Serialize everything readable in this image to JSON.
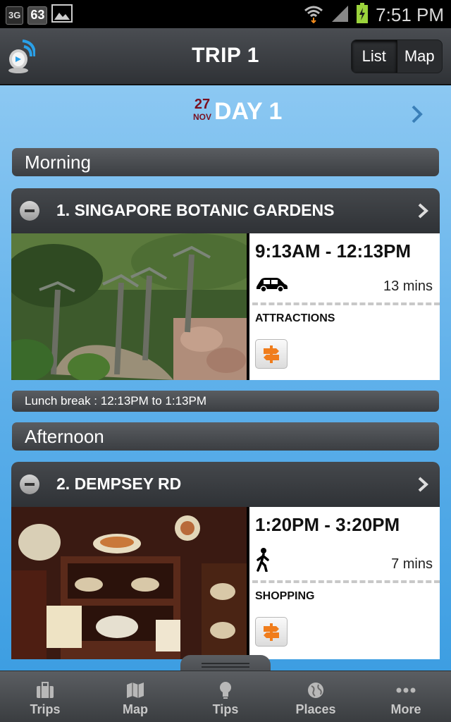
{
  "status_bar": {
    "network_label": "3G",
    "battery_notification": "63",
    "time": "7:51 PM"
  },
  "header": {
    "title": "TRIP 1",
    "view_toggle": {
      "list_label": "List",
      "map_label": "Map",
      "selected": "List"
    }
  },
  "day": {
    "date_day": "27",
    "date_month": "NOV",
    "label": "DAY 1"
  },
  "sections": {
    "morning": "Morning",
    "afternoon": "Afternoon",
    "lunch_break": "Lunch break : 12:13PM to 1:13PM"
  },
  "itinerary": [
    {
      "title": "1. SINGAPORE BOTANIC GARDENS",
      "time_range": "9:13AM - 12:13PM",
      "travel_mode_icon": "car-icon",
      "travel_time": "13 mins",
      "category": "ATTRACTIONS",
      "category_icon": "signpost-icon"
    },
    {
      "title": "2. DEMPSEY RD",
      "time_range": "1:20PM - 3:20PM",
      "travel_mode_icon": "walking-icon",
      "travel_time": "7 mins",
      "category": "SHOPPING",
      "category_icon": "signpost-icon"
    }
  ],
  "tabs": [
    {
      "label": "Trips",
      "icon": "suitcase-icon"
    },
    {
      "label": "Map",
      "icon": "map-icon"
    },
    {
      "label": "Tips",
      "icon": "lightbulb-icon"
    },
    {
      "label": "Places",
      "icon": "globe-icon"
    },
    {
      "label": "More",
      "icon": "more-dots-icon"
    }
  ],
  "colors": {
    "accent_signpost": "#f07d1c",
    "date_red": "#7a1020",
    "content_blue": "#5fb0ea"
  }
}
